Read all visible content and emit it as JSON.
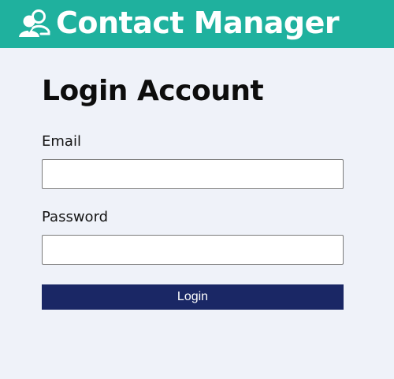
{
  "header": {
    "title": "Contact Manager",
    "icon": "users-icon",
    "background_color": "#1fb19e"
  },
  "login": {
    "heading": "Login Account",
    "email_label": "Email",
    "email_value": "",
    "password_label": "Password",
    "password_value": "",
    "submit_label": "Login",
    "button_color": "#1a2765"
  }
}
